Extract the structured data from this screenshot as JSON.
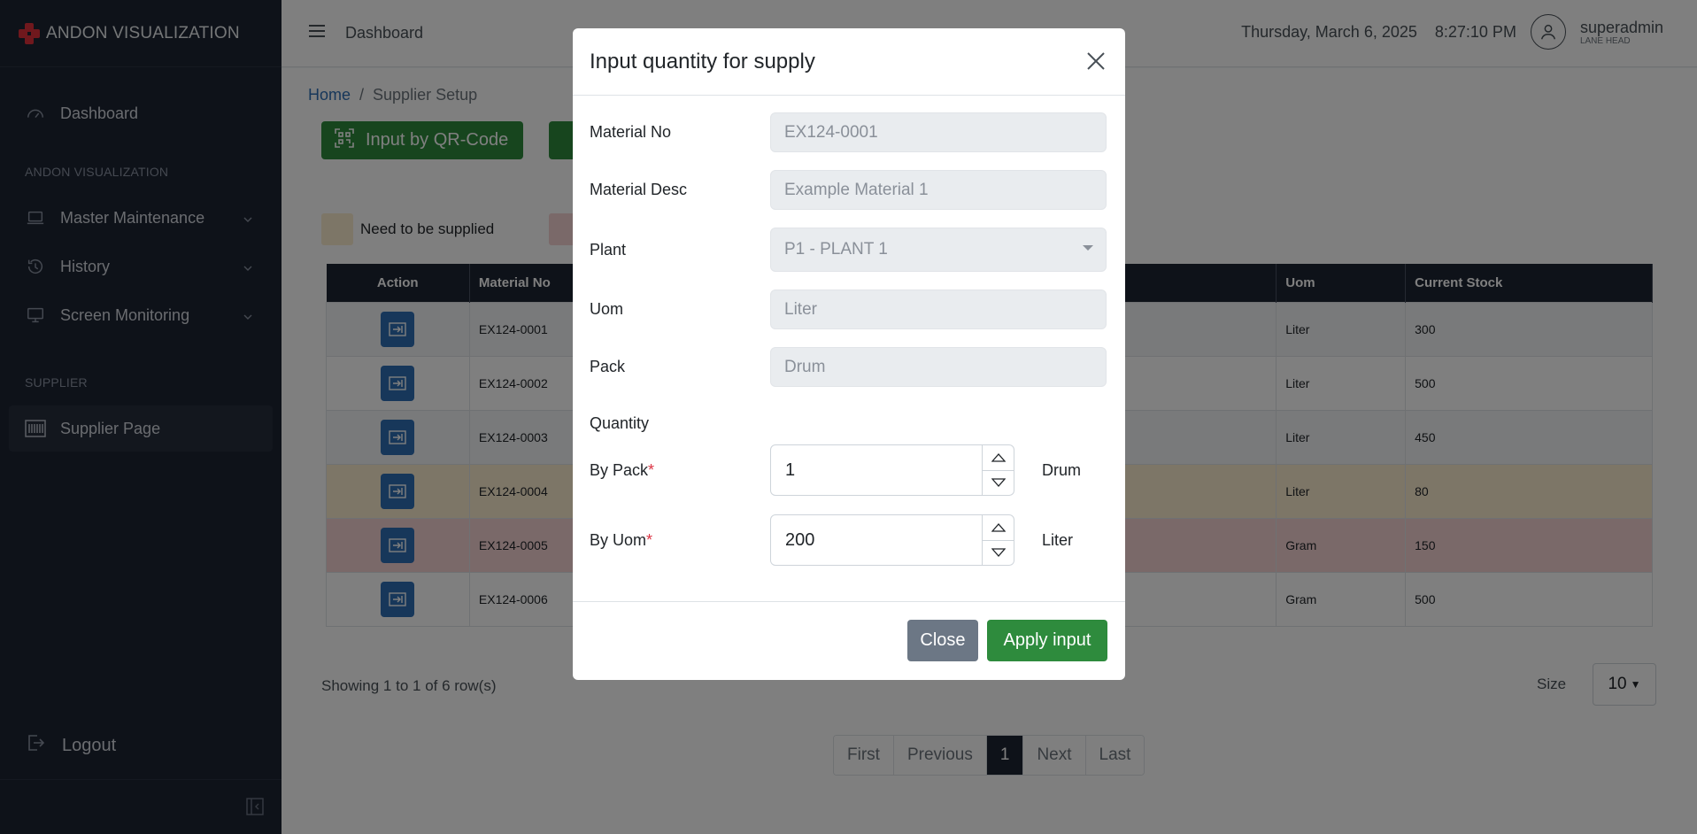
{
  "app": {
    "title": "ANDON VISUALIZATION"
  },
  "sidebar": {
    "dashboard_label": "Dashboard",
    "section_andon": "ANDON VISUALIZATION",
    "items": [
      {
        "label": "Master Maintenance"
      },
      {
        "label": "History"
      },
      {
        "label": "Screen Monitoring"
      }
    ],
    "section_supplier": "SUPPLIER",
    "supplier_page_label": "Supplier Page",
    "logout_label": "Logout"
  },
  "topbar": {
    "title": "Dashboard",
    "date": "Thursday, March 6, 2025",
    "time": "8:27:10 PM",
    "user_name": "superadmin",
    "user_role": "LANE HEAD"
  },
  "breadcrumb": {
    "home": "Home",
    "separator": "/",
    "current": "Supplier Setup"
  },
  "main": {
    "input_qr_label": "Input by QR-Code",
    "legend_need_supply": "Need to be supplied",
    "colors": {
      "need_supply": "#fbeccf",
      "critical": "#f4d2d3",
      "primary": "#2f6eb5",
      "success": "#2e8b3d",
      "dark": "#1d2432"
    }
  },
  "table": {
    "headers": [
      "Action",
      "Material No",
      "Uom",
      "Current Stock"
    ],
    "rows": [
      {
        "material_no": "EX124-0001",
        "uom": "Liter",
        "stock": "300"
      },
      {
        "material_no": "EX124-0002",
        "uom": "Liter",
        "stock": "500"
      },
      {
        "material_no": "EX124-0003",
        "uom": "Liter",
        "stock": "450"
      },
      {
        "material_no": "EX124-0004",
        "uom": "Liter",
        "stock": "80"
      },
      {
        "material_no": "EX124-0005",
        "uom": "Gram",
        "stock": "150"
      },
      {
        "material_no": "EX124-0006",
        "uom": "Gram",
        "stock": "500"
      }
    ]
  },
  "pagination": {
    "showing": "Showing 1 to 1 of 6 row(s)",
    "size_label": "Size",
    "size_value": "10",
    "first": "First",
    "previous": "Previous",
    "current": "1",
    "next": "Next",
    "last": "Last"
  },
  "modal": {
    "title": "Input quantity for supply",
    "material_no_label": "Material No",
    "material_no_value": "EX124-0001",
    "material_desc_label": "Material Desc",
    "material_desc_value": "Example Material 1",
    "plant_label": "Plant",
    "plant_value": "P1 - PLANT 1",
    "uom_label": "Uom",
    "uom_value": "Liter",
    "pack_label": "Pack",
    "pack_value": "Drum",
    "quantity_label": "Quantity",
    "by_pack_label": "By Pack",
    "by_pack_value": "1",
    "by_pack_unit": "Drum",
    "by_uom_label": "By Uom",
    "by_uom_value": "200",
    "by_uom_unit": "Liter",
    "required_mark": "*",
    "close_label": "Close",
    "apply_label": "Apply input"
  }
}
